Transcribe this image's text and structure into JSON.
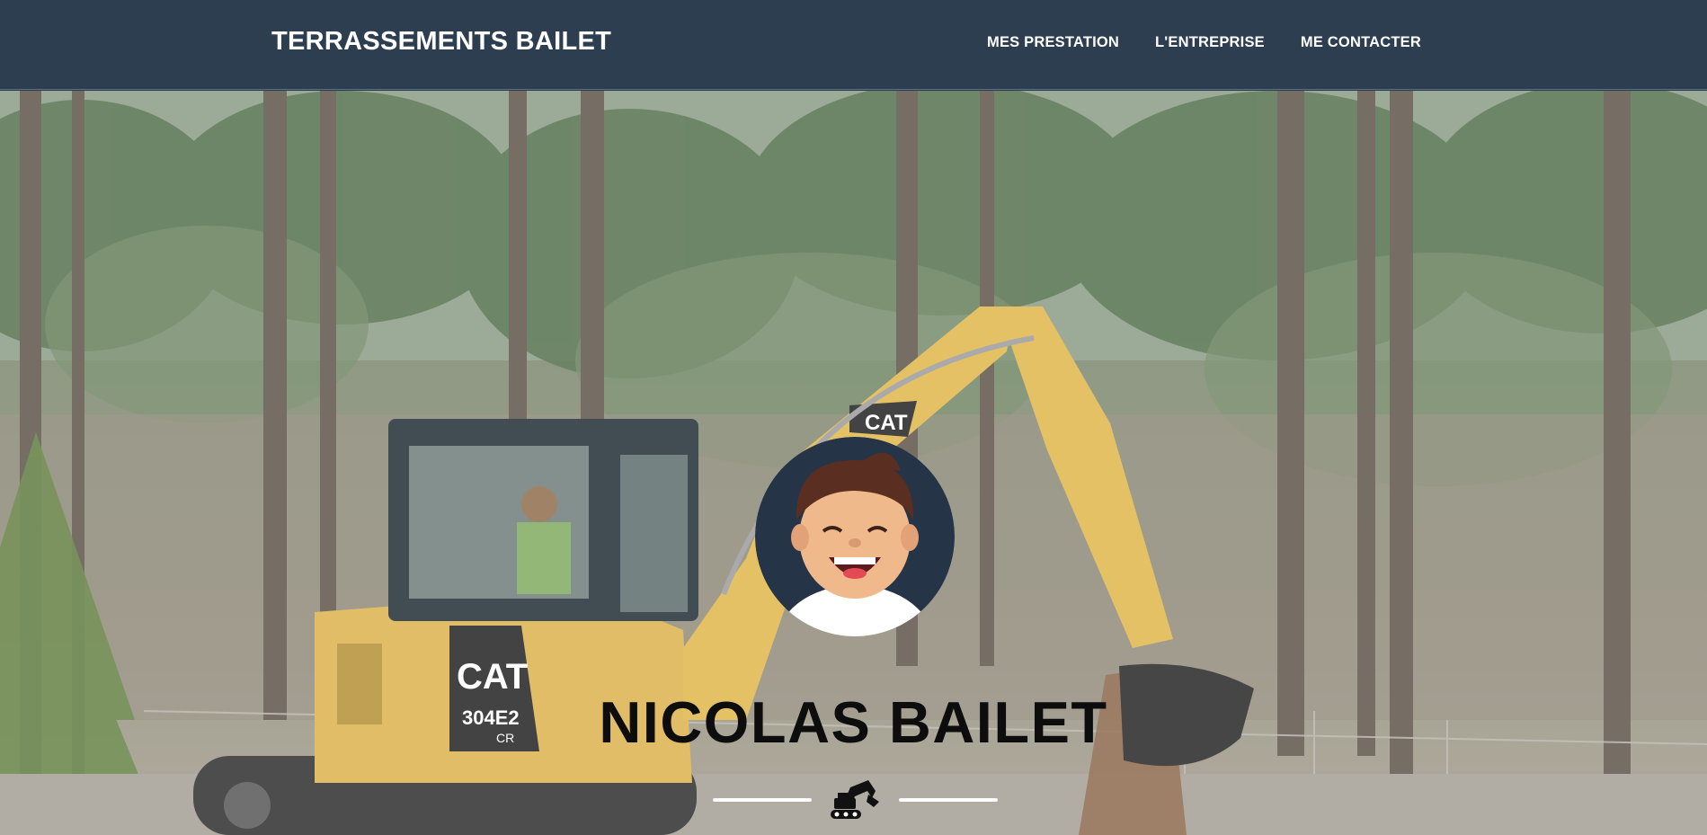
{
  "navbar": {
    "brand": "TERRASSEMENTS BAILET",
    "links": [
      {
        "label": "MES PRESTATION"
      },
      {
        "label": "L'ENTREPRISE"
      },
      {
        "label": "ME CONTACTER"
      }
    ]
  },
  "hero": {
    "heading": "NICOLAS BAILET",
    "machine": {
      "brand_label": "CAT",
      "model_label": "304E2",
      "sub_label": "CR"
    }
  },
  "colors": {
    "navbar_bg": "#2c3e50",
    "accent": "#e8b94f",
    "avatar_bg": "#253447",
    "heading": "#0d0d0d"
  },
  "icons": [
    "avatar-icon",
    "excavator-icon"
  ]
}
